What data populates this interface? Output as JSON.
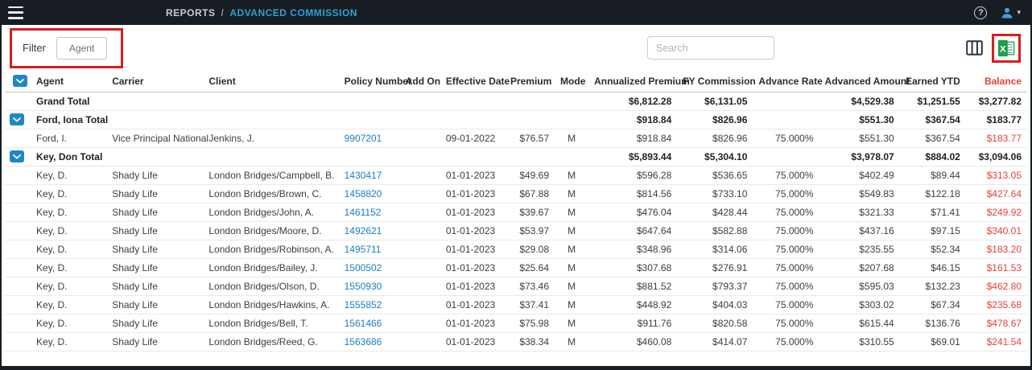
{
  "topbar": {
    "breadcrumb": {
      "section": "REPORTS",
      "separator": "/",
      "page": "ADVANCED COMMISSION"
    }
  },
  "toolbar": {
    "filter_label": "Filter",
    "filter_value": "Agent",
    "search_placeholder": "Search"
  },
  "table": {
    "columns": [
      {
        "key": "agent",
        "label": "Agent",
        "align": "left"
      },
      {
        "key": "carrier",
        "label": "Carrier",
        "align": "left"
      },
      {
        "key": "client",
        "label": "Client",
        "align": "left"
      },
      {
        "key": "policy",
        "label": "Policy Number",
        "align": "left"
      },
      {
        "key": "addon",
        "label": "Add On",
        "align": "left"
      },
      {
        "key": "effective_date",
        "label": "Effective Date",
        "align": "left"
      },
      {
        "key": "premium",
        "label": "Premium",
        "align": "right"
      },
      {
        "key": "mode",
        "label": "Mode",
        "align": "center"
      },
      {
        "key": "annualized_premium",
        "label": "Annualized Premium",
        "align": "right"
      },
      {
        "key": "fy_commission",
        "label": "FY Commission",
        "align": "right"
      },
      {
        "key": "advance_rate",
        "label": "Advance Rate",
        "align": "right"
      },
      {
        "key": "advanced_amount",
        "label": "Advanced Amount",
        "align": "right"
      },
      {
        "key": "earned_ytd",
        "label": "Earned YTD",
        "align": "right"
      },
      {
        "key": "balance",
        "label": "Balance",
        "align": "right"
      }
    ],
    "rows": [
      {
        "type": "grand",
        "cells": [
          "Grand Total",
          "",
          "",
          "",
          "",
          "",
          "",
          "",
          "$6,812.28",
          "$6,131.05",
          "",
          "$4,529.38",
          "$1,251.55",
          "$3,277.82"
        ]
      },
      {
        "type": "group",
        "cells": [
          "Ford, Iona Total",
          "",
          "",
          "",
          "",
          "",
          "",
          "",
          "$918.84",
          "$826.96",
          "",
          "$551.30",
          "$367.54",
          "$183.77"
        ]
      },
      {
        "type": "detail",
        "cells": [
          "Ford, I.",
          "Vice Principal National",
          "Jenkins, J.",
          "9907201",
          "",
          "09-01-2022",
          "$76.57",
          "M",
          "$918.84",
          "$826.96",
          "75.000%",
          "$551.30",
          "$367.54",
          "$183.77"
        ]
      },
      {
        "type": "group",
        "cells": [
          "Key, Don Total",
          "",
          "",
          "",
          "",
          "",
          "",
          "",
          "$5,893.44",
          "$5,304.10",
          "",
          "$3,978.07",
          "$884.02",
          "$3,094.06"
        ]
      },
      {
        "type": "detail",
        "cells": [
          "Key, D.",
          "Shady Life",
          "London Bridges/Campbell, B.",
          "1430417",
          "",
          "01-01-2023",
          "$49.69",
          "M",
          "$596.28",
          "$536.65",
          "75.000%",
          "$402.49",
          "$89.44",
          "$313.05"
        ]
      },
      {
        "type": "detail",
        "cells": [
          "Key, D.",
          "Shady Life",
          "London Bridges/Brown, C.",
          "1458820",
          "",
          "01-01-2023",
          "$67.88",
          "M",
          "$814.56",
          "$733.10",
          "75.000%",
          "$549.83",
          "$122.18",
          "$427.64"
        ]
      },
      {
        "type": "detail",
        "cells": [
          "Key, D.",
          "Shady Life",
          "London Bridges/John, A.",
          "1461152",
          "",
          "01-01-2023",
          "$39.67",
          "M",
          "$476.04",
          "$428.44",
          "75.000%",
          "$321.33",
          "$71.41",
          "$249.92"
        ]
      },
      {
        "type": "detail",
        "cells": [
          "Key, D.",
          "Shady Life",
          "London Bridges/Moore, D.",
          "1492621",
          "",
          "01-01-2023",
          "$53.97",
          "M",
          "$647.64",
          "$582.88",
          "75.000%",
          "$437.16",
          "$97.15",
          "$340.01"
        ]
      },
      {
        "type": "detail",
        "cells": [
          "Key, D.",
          "Shady Life",
          "London Bridges/Robinson, A.",
          "1495711",
          "",
          "01-01-2023",
          "$29.08",
          "M",
          "$348.96",
          "$314.06",
          "75.000%",
          "$235.55",
          "$52.34",
          "$183.20"
        ]
      },
      {
        "type": "detail",
        "cells": [
          "Key, D.",
          "Shady Life",
          "London Bridges/Bailey, J.",
          "1500502",
          "",
          "01-01-2023",
          "$25.64",
          "M",
          "$307.68",
          "$276.91",
          "75.000%",
          "$207.68",
          "$46.15",
          "$161.53"
        ]
      },
      {
        "type": "detail",
        "cells": [
          "Key, D.",
          "Shady Life",
          "London Bridges/Olson, D.",
          "1550930",
          "",
          "01-01-2023",
          "$73.46",
          "M",
          "$881.52",
          "$793.37",
          "75.000%",
          "$595.03",
          "$132.23",
          "$462.80"
        ]
      },
      {
        "type": "detail",
        "cells": [
          "Key, D.",
          "Shady Life",
          "London Bridges/Hawkins, A.",
          "1555852",
          "",
          "01-01-2023",
          "$37.41",
          "M",
          "$448.92",
          "$404.03",
          "75.000%",
          "$303.02",
          "$67.34",
          "$235.68"
        ]
      },
      {
        "type": "detail",
        "cells": [
          "Key, D.",
          "Shady Life",
          "London Bridges/Bell, T.",
          "1561466",
          "",
          "01-01-2023",
          "$75.98",
          "M",
          "$911.76",
          "$820.58",
          "75.000%",
          "$615.44",
          "$136.76",
          "$478.67"
        ]
      },
      {
        "type": "detail",
        "cells": [
          "Key, D.",
          "Shady Life",
          "London Bridges/Reed, G.",
          "1563686",
          "",
          "01-01-2023",
          "$38.34",
          "M",
          "$460.08",
          "$414.07",
          "75.000%",
          "$310.55",
          "$69.01",
          "$241.54"
        ]
      }
    ]
  },
  "colors": {
    "accent_blue": "#1f87c9",
    "link_blue": "#1b7ec2",
    "balance_red": "#e5423a",
    "annotation_red": "#d81e1e",
    "excel_green": "#1e9e4e",
    "topbar_bg": "#171d22"
  }
}
